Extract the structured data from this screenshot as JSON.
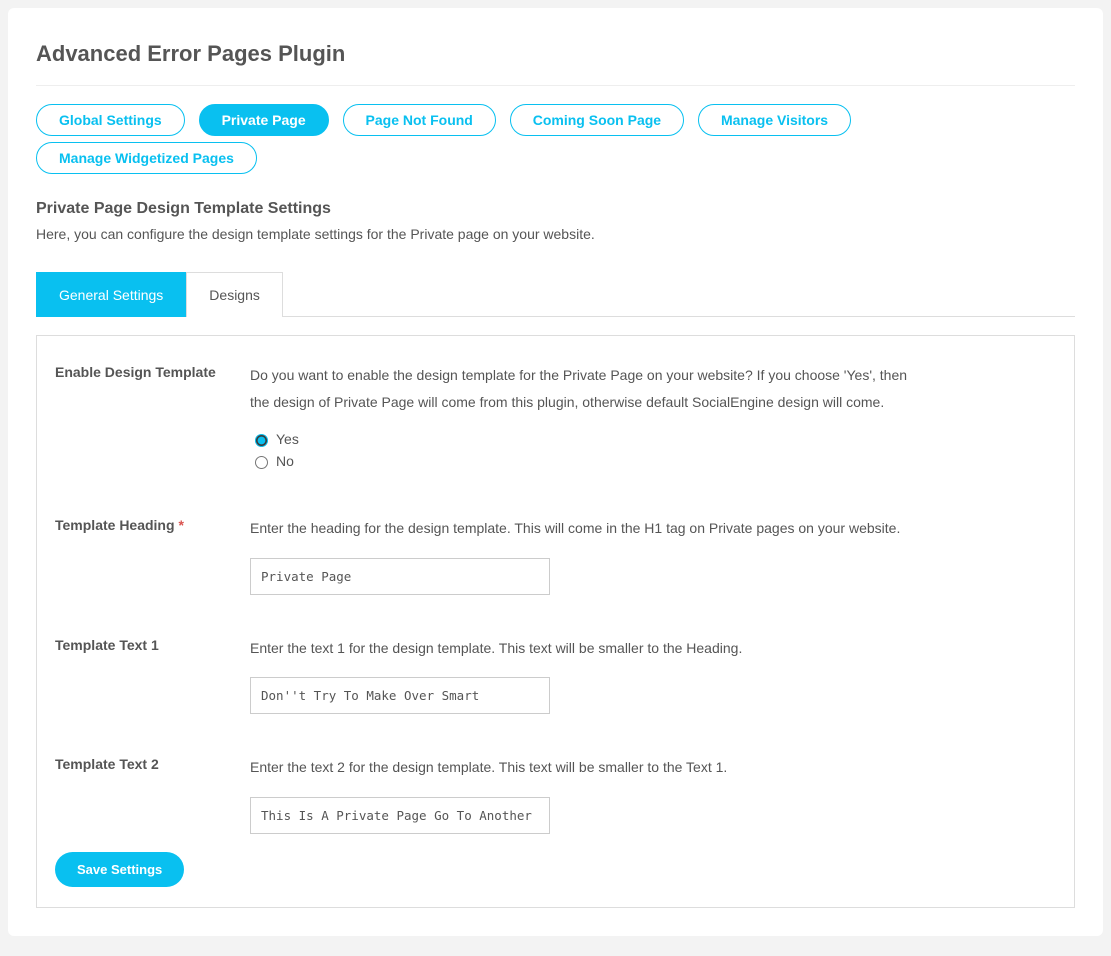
{
  "page_title": "Advanced Error Pages Plugin",
  "main_tabs": [
    {
      "label": "Global Settings",
      "active": false
    },
    {
      "label": "Private Page",
      "active": true
    },
    {
      "label": "Page Not Found",
      "active": false
    },
    {
      "label": "Coming Soon Page",
      "active": false
    },
    {
      "label": "Manage Visitors",
      "active": false
    },
    {
      "label": "Manage Widgetized Pages",
      "active": false
    }
  ],
  "section_title": "Private Page Design Template Settings",
  "section_desc": "Here, you can configure the design template settings for the Private page on your website.",
  "sub_tabs": [
    {
      "label": "General Settings",
      "active": true
    },
    {
      "label": "Designs",
      "active": false
    }
  ],
  "fields": {
    "enable": {
      "label": "Enable Design Template",
      "help": "Do you want to enable the design template for the Private Page on your website? If you choose 'Yes', then the design of Private Page will come from this plugin, otherwise default SocialEngine design will come.",
      "opt_yes": "Yes",
      "opt_no": "No",
      "value": "yes"
    },
    "heading": {
      "label": "Template Heading",
      "required": true,
      "help": "Enter the heading for the design template. This will come in the H1 tag on Private pages on your website.",
      "value": "Private Page"
    },
    "text1": {
      "label": "Template Text 1",
      "help": "Enter the text 1 for the design template. This text will be smaller to the Heading.",
      "value": "Don''t Try To Make Over Smart"
    },
    "text2": {
      "label": "Template Text 2",
      "help": "Enter the text 2 for the design template. This text will be smaller to the Text 1.",
      "value": "This Is A Private Page Go To Another Page An"
    }
  },
  "save_label": "Save Settings"
}
